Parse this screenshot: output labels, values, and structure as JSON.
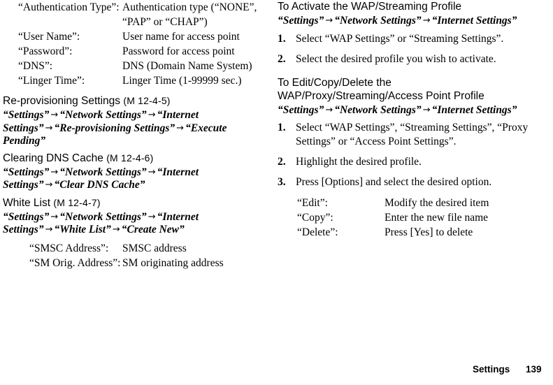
{
  "page": {
    "footer_label": "Settings",
    "footer_page_number": "139",
    "arrow_glyph": "→"
  },
  "left_column": {
    "top_definitions": [
      {
        "term": "“Authentication Type”:",
        "desc": "Authentication type (“NONE”, “PAP” or “CHAP”)"
      },
      {
        "term": "“User Name”:",
        "desc": "User name for access point"
      },
      {
        "term": "“Password”:",
        "desc": "Password for access point"
      },
      {
        "term": "“DNS”:",
        "desc": "DNS (Domain Name System)"
      },
      {
        "term": "“Linger Time”:",
        "desc": "Linger Time (1-99999 sec.)"
      }
    ],
    "sections": [
      {
        "title": "Re-provisioning Settings",
        "code": "(M 12-4-5)",
        "path": [
          "“Settings”",
          "“Network Settings”",
          "“Internet Settings”",
          "“Re-provisioning Settings”",
          "“Execute Pending”"
        ]
      },
      {
        "title": "Clearing DNS Cache",
        "code": "(M 12-4-6)",
        "path": [
          "“Settings”",
          "“Network Settings”",
          "“Internet Settings”",
          "“Clear DNS Cache”"
        ]
      },
      {
        "title": "White List",
        "code": "(M 12-4-7)",
        "path": [
          "“Settings”",
          "“Network Settings”",
          "“Internet Settings”",
          "“White List”",
          "“Create New”"
        ],
        "definitions": [
          {
            "term": "“SMSC Address”:",
            "desc": "SMSC address"
          },
          {
            "term": "“SM Orig. Address”:",
            "desc": "SM originating address"
          }
        ]
      }
    ]
  },
  "right_column": {
    "sections": [
      {
        "title": "To Activate the WAP/Streaming Profile",
        "path": [
          "“Settings”",
          "“Network Settings”",
          "“Internet Settings”"
        ],
        "steps": [
          {
            "num": "1.",
            "text": "Select “WAP Settings” or “Streaming Settings”."
          },
          {
            "num": "2.",
            "text": "Select the desired profile you wish to activate."
          }
        ]
      },
      {
        "title": "To Edit/Copy/Delete the WAP/Proxy/Streaming/Access Point Profile",
        "path": [
          "“Settings”",
          "“Network Settings”",
          "“Internet Settings”"
        ],
        "steps": [
          {
            "num": "1.",
            "text": "Select “WAP Settings”, “Streaming Settings”, “Proxy Settings” or “Access Point Settings”."
          },
          {
            "num": "2.",
            "text": "Highlight the desired profile."
          },
          {
            "num": "3.",
            "text": "Press [Options] and select the desired option."
          }
        ],
        "definitions": [
          {
            "term": "“Edit”:",
            "desc": "Modify the desired item"
          },
          {
            "term": "“Copy”:",
            "desc": "Enter the new file name"
          },
          {
            "term": "“Delete”:",
            "desc": "Press [Yes] to delete"
          }
        ]
      }
    ]
  }
}
